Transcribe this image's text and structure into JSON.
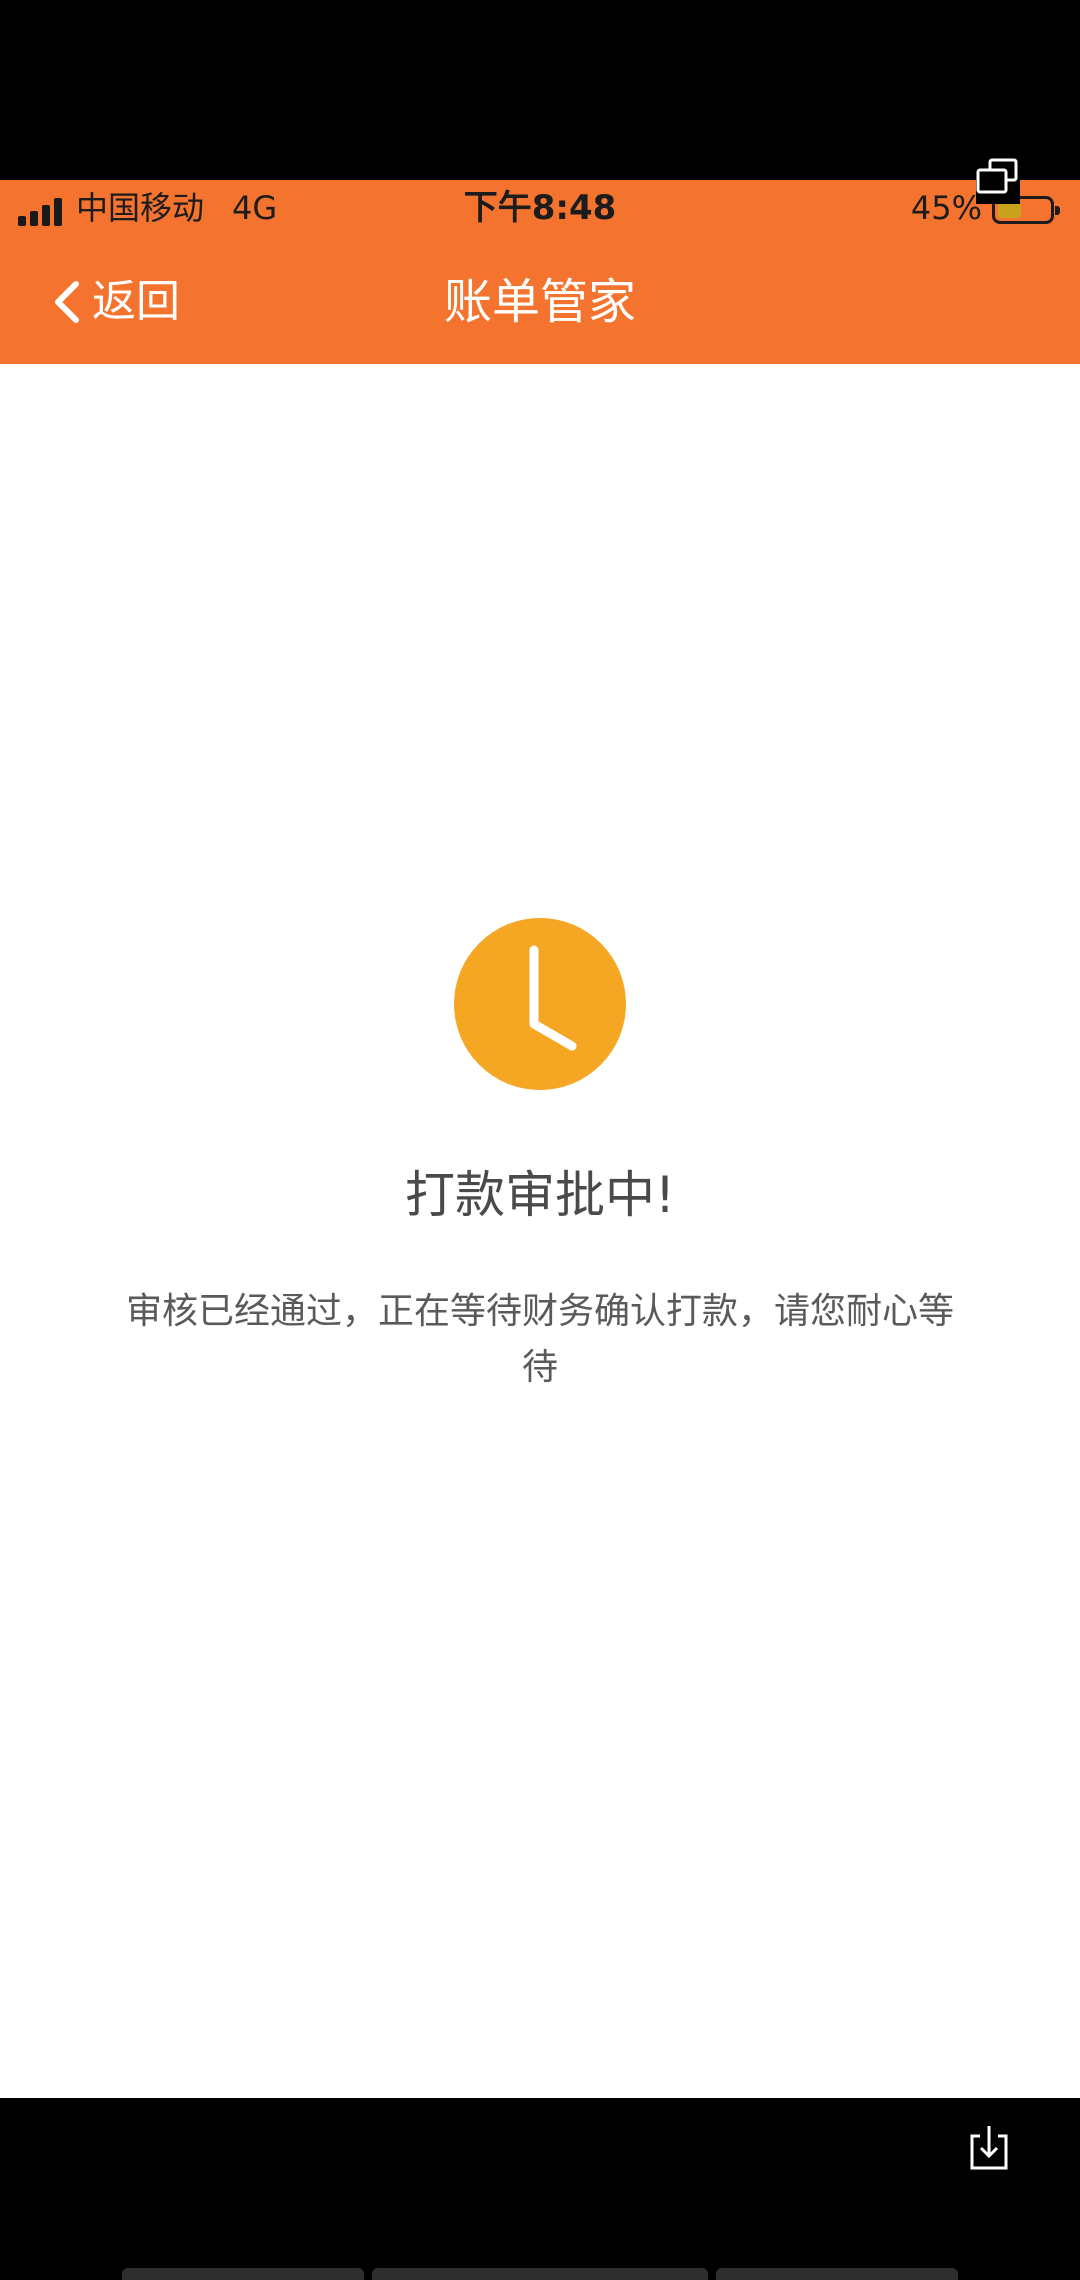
{
  "status_bar": {
    "carrier": "中国移动",
    "network": "4G",
    "time": "下午8:48",
    "battery_percent": "45%",
    "battery_level": 0.45
  },
  "nav": {
    "back_label": "返回",
    "title": "账单管家"
  },
  "main": {
    "status_title": "打款审批中!",
    "status_description": "审核已经通过，正在等待财务确认打款，请您耐心等待"
  },
  "colors": {
    "header_bg": "#f4732e",
    "clock_icon": "#f5a623",
    "page_bg": "#ffffff"
  },
  "icons": {
    "back": "chevron-left-icon",
    "status": "clock-icon",
    "overlay": "window-stack-icon",
    "share": "download-tray-icon"
  }
}
